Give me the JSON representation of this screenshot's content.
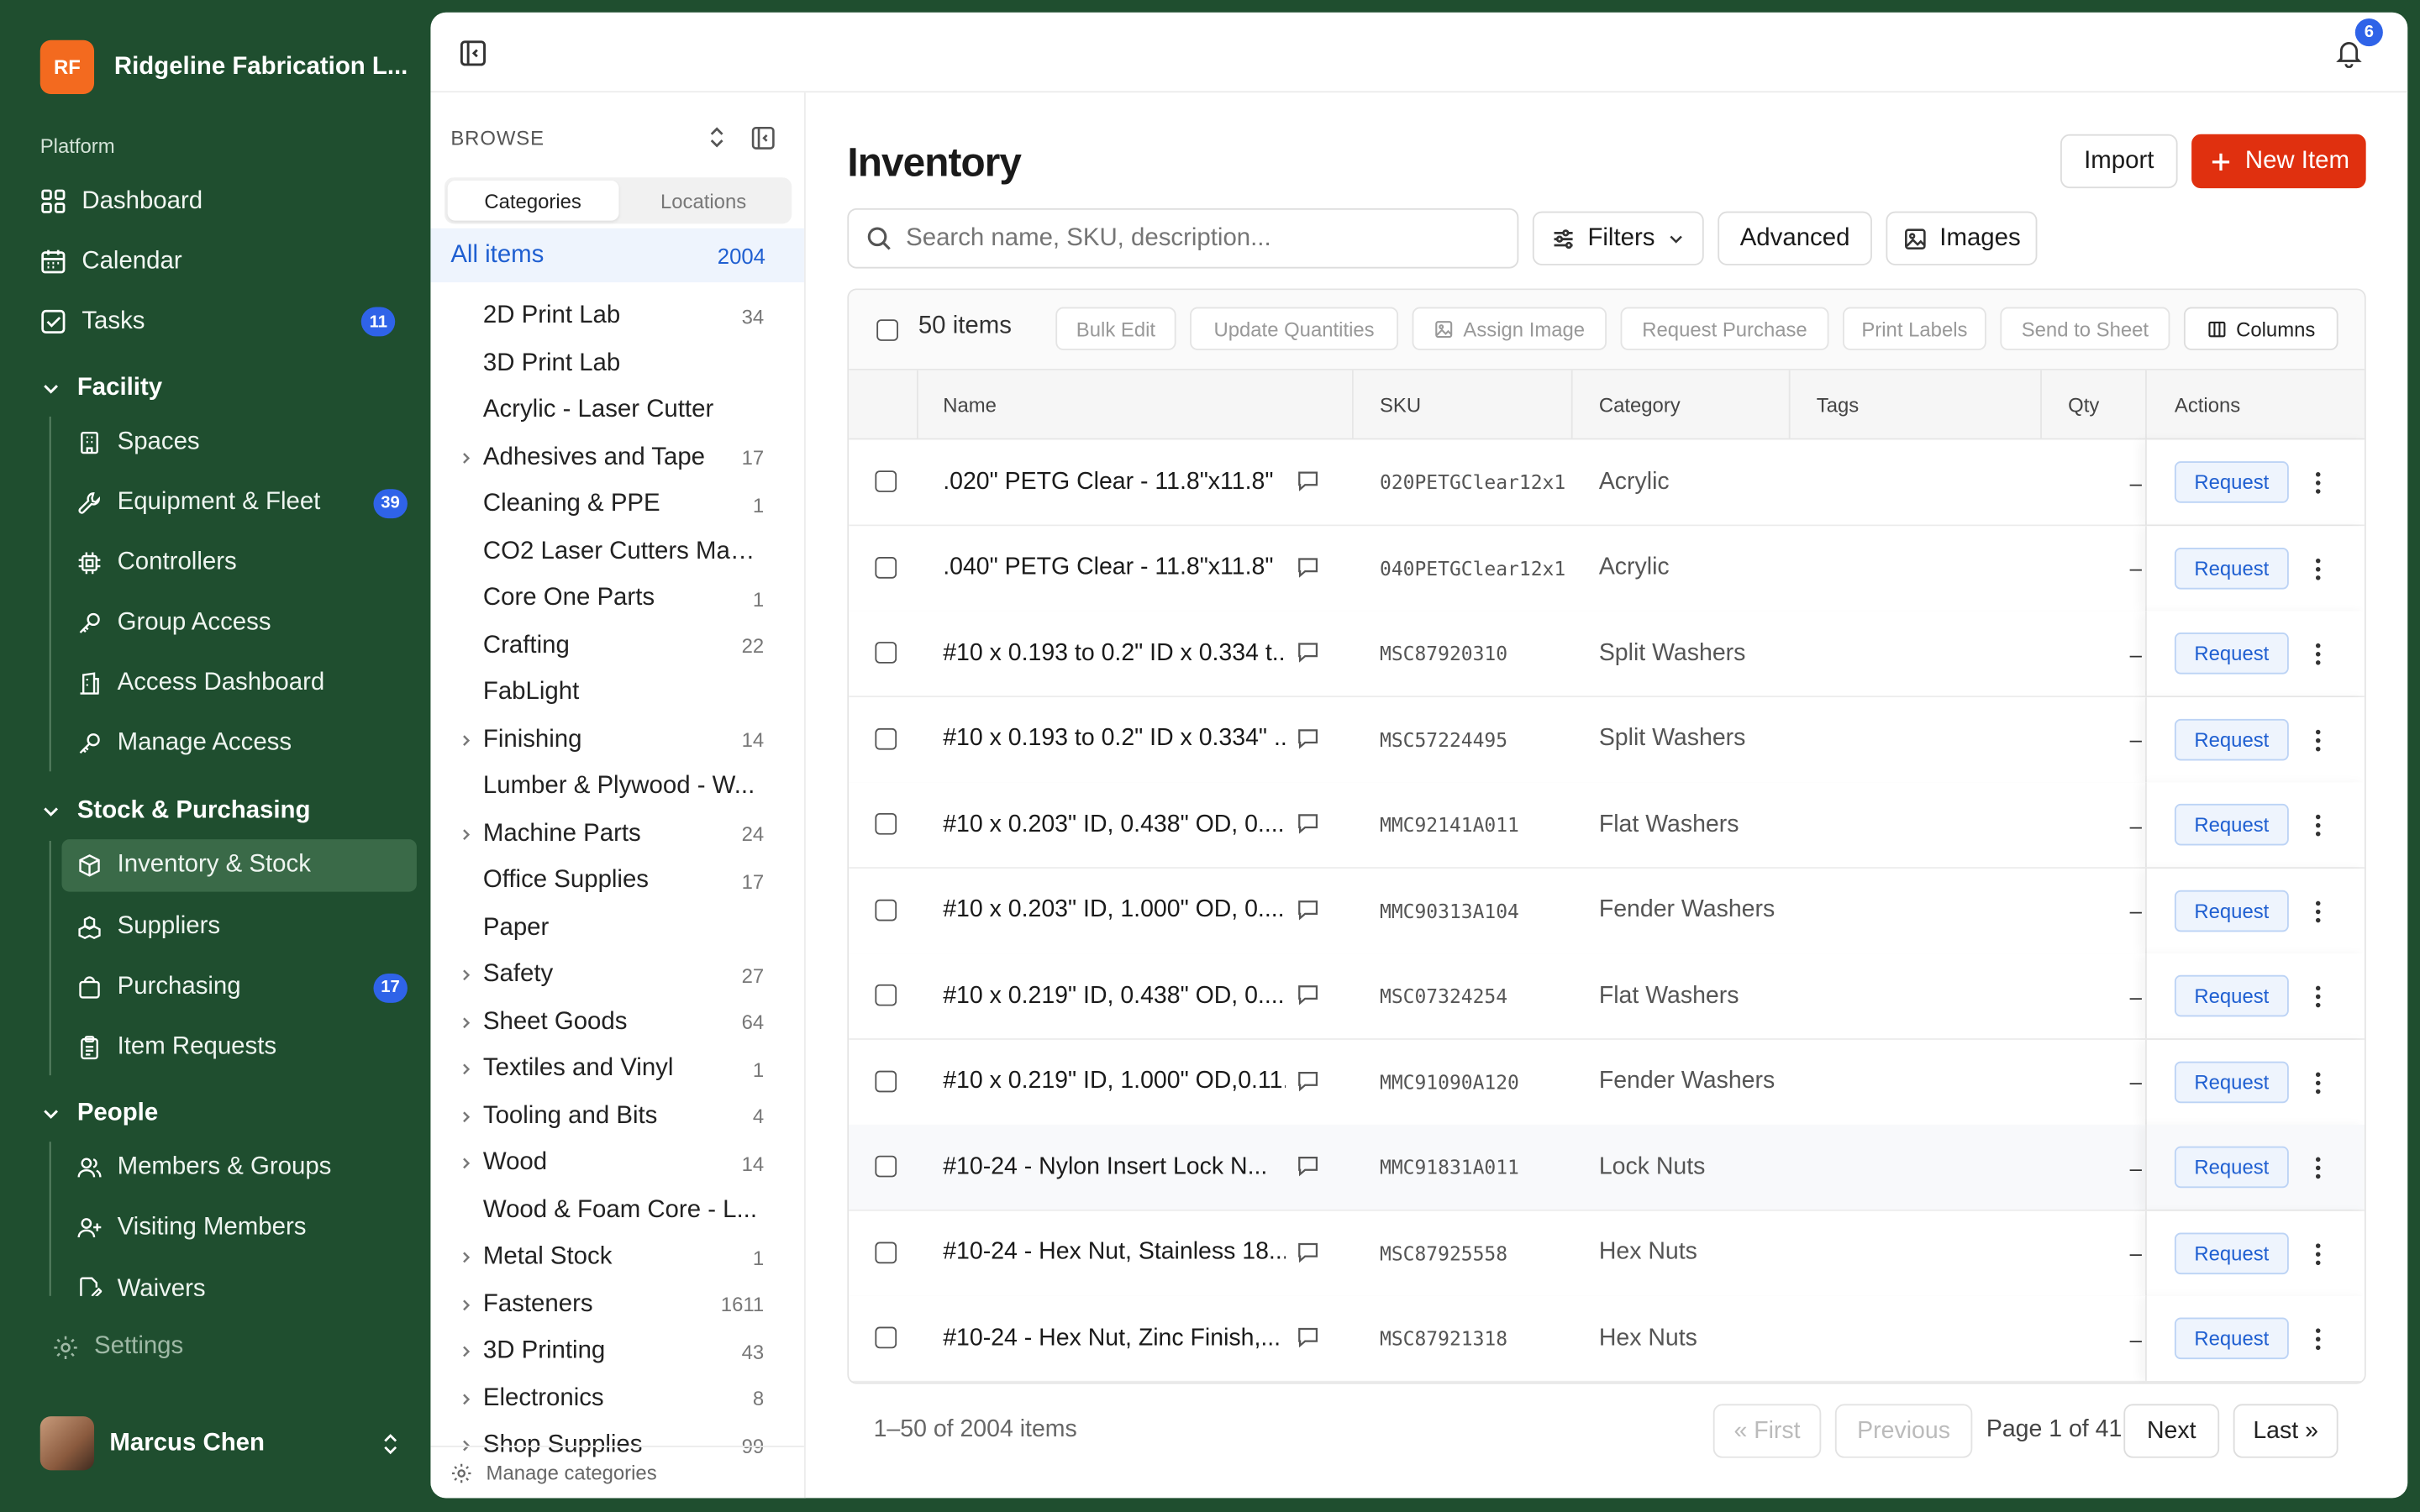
{
  "org": {
    "initials": "RF",
    "name": "Ridgeline Fabrication L..."
  },
  "sidebar": {
    "platform_label": "Platform",
    "platform_items": [
      {
        "label": "Dashboard",
        "icon": "grid-icon"
      },
      {
        "label": "Calendar",
        "icon": "calendar-icon"
      },
      {
        "label": "Tasks",
        "icon": "checkbox-icon",
        "badge": "11"
      }
    ],
    "groups": [
      {
        "label": "Facility",
        "items": [
          {
            "label": "Spaces",
            "icon": "building-icon"
          },
          {
            "label": "Equipment & Fleet",
            "icon": "wrench-icon",
            "badge": "39"
          },
          {
            "label": "Controllers",
            "icon": "chip-icon"
          },
          {
            "label": "Group Access",
            "icon": "key-icon"
          },
          {
            "label": "Access Dashboard",
            "icon": "building-icon"
          },
          {
            "label": "Manage Access",
            "icon": "key-icon"
          }
        ]
      },
      {
        "label": "Stock & Purchasing",
        "items": [
          {
            "label": "Inventory & Stock",
            "icon": "box-icon",
            "active": true
          },
          {
            "label": "Suppliers",
            "icon": "boxes-icon"
          },
          {
            "label": "Purchasing",
            "icon": "bag-icon",
            "badge": "17"
          },
          {
            "label": "Item Requests",
            "icon": "clipboard-icon"
          }
        ]
      },
      {
        "label": "People",
        "items": [
          {
            "label": "Members & Groups",
            "icon": "users-icon"
          },
          {
            "label": "Visiting Members",
            "icon": "user-plus-icon"
          },
          {
            "label": "Waivers",
            "icon": "doc-pen-icon"
          }
        ]
      }
    ],
    "settings_label": "Settings",
    "user_name": "Marcus Chen"
  },
  "topbar": {
    "notification_count": "6"
  },
  "browse": {
    "title": "BROWSE",
    "tabs": [
      "Categories",
      "Locations"
    ],
    "all_items": {
      "label": "All items",
      "count": "2004"
    },
    "categories": [
      {
        "label": "2D Print Lab",
        "count": "34",
        "expand": false
      },
      {
        "label": "3D Print Lab",
        "count": "",
        "expand": false
      },
      {
        "label": "Acrylic - Laser Cutter",
        "count": "",
        "expand": false
      },
      {
        "label": "Adhesives and Tape",
        "count": "17",
        "expand": true
      },
      {
        "label": "Cleaning & PPE",
        "count": "1",
        "expand": false
      },
      {
        "label": "CO2 Laser Cutters Main...",
        "count": "",
        "expand": false
      },
      {
        "label": "Core One Parts",
        "count": "1",
        "expand": false
      },
      {
        "label": "Crafting",
        "count": "22",
        "expand": false
      },
      {
        "label": "FabLight",
        "count": "",
        "expand": false
      },
      {
        "label": "Finishing",
        "count": "14",
        "expand": true
      },
      {
        "label": "Lumber & Plywood - W...",
        "count": "",
        "expand": false
      },
      {
        "label": "Machine Parts",
        "count": "24",
        "expand": true
      },
      {
        "label": "Office Supplies",
        "count": "17",
        "expand": false
      },
      {
        "label": "Paper",
        "count": "",
        "expand": false
      },
      {
        "label": "Safety",
        "count": "27",
        "expand": true
      },
      {
        "label": "Sheet Goods",
        "count": "64",
        "expand": true
      },
      {
        "label": "Textiles and Vinyl",
        "count": "1",
        "expand": true
      },
      {
        "label": "Tooling and Bits",
        "count": "4",
        "expand": true
      },
      {
        "label": "Wood",
        "count": "14",
        "expand": true
      },
      {
        "label": "Wood & Foam Core - L...",
        "count": "",
        "expand": false
      },
      {
        "label": "Metal Stock",
        "count": "1",
        "expand": true
      },
      {
        "label": "Fasteners",
        "count": "1611",
        "expand": true
      },
      {
        "label": "3D Printing",
        "count": "43",
        "expand": true
      },
      {
        "label": "Electronics",
        "count": "8",
        "expand": true
      },
      {
        "label": "Shop Supplies",
        "count": "99",
        "expand": true
      }
    ],
    "manage_label": "Manage categories"
  },
  "page": {
    "title": "Inventory",
    "import_label": "Import",
    "new_item_label": "New Item",
    "search_placeholder": "Search name, SKU, description...",
    "filters_label": "Filters",
    "advanced_label": "Advanced",
    "images_label": "Images"
  },
  "toolbar": {
    "count_label": "50 items",
    "bulk_edit": "Bulk Edit",
    "update_quantities": "Update Quantities",
    "assign_image": "Assign Image",
    "request_purchase": "Request Purchase",
    "print_labels": "Print Labels",
    "send_to_sheet": "Send to Sheet",
    "columns": "Columns"
  },
  "table": {
    "headers": {
      "name": "Name",
      "sku": "SKU",
      "category": "Category",
      "tags": "Tags",
      "qty": "Qty",
      "actions": "Actions"
    },
    "request_label": "Request",
    "rows": [
      {
        "name": ".020\" PETG Clear - 11.8\"x11.8\"",
        "sku": "020PETGClear12x1",
        "category": "Acrylic",
        "qty": "–"
      },
      {
        "name": ".040\" PETG Clear - 11.8\"x11.8\"",
        "sku": "040PETGClear12x1",
        "category": "Acrylic",
        "qty": "–"
      },
      {
        "name": "#10 x 0.193 to 0.2\" ID x 0.334 t...",
        "sku": "MSC87920310",
        "category": "Split Washers",
        "qty": "–"
      },
      {
        "name": "#10 x 0.193 to 0.2\" ID x 0.334\" ...",
        "sku": "MSC57224495",
        "category": "Split Washers",
        "qty": "–"
      },
      {
        "name": "#10 x 0.203\" ID, 0.438\" OD, 0....",
        "sku": "MMC92141A011",
        "category": "Flat Washers",
        "qty": "–"
      },
      {
        "name": "#10 x 0.203\" ID, 1.000\" OD, 0....",
        "sku": "MMC90313A104",
        "category": "Fender Washers",
        "qty": "–"
      },
      {
        "name": "#10 x 0.219\" ID, 0.438\" OD, 0....",
        "sku": "MSC07324254",
        "category": "Flat Washers",
        "qty": "–"
      },
      {
        "name": "#10 x 0.219\" ID, 1.000\" OD,0.11...",
        "sku": "MMC91090A120",
        "category": "Fender Washers",
        "qty": "–"
      },
      {
        "name": "#10-24 - Nylon Insert Lock N...",
        "sku": "MMC91831A011",
        "category": "Lock Nuts",
        "qty": "–"
      },
      {
        "name": "#10-24 - Hex Nut, Stainless 18...",
        "sku": "MSC87925558",
        "category": "Hex Nuts",
        "qty": "–"
      },
      {
        "name": "#10-24 - Hex Nut, Zinc Finish,...",
        "sku": "MSC87921318",
        "category": "Hex Nuts",
        "qty": "–"
      }
    ]
  },
  "pagination": {
    "summary": "1–50 of 2004 items",
    "first": "« First",
    "previous": "Previous",
    "page_info": "Page 1 of 41",
    "next": "Next",
    "last": "Last »"
  },
  "colors": {
    "sidebar_bg": "#1f4e2f",
    "accent": "#e0300f",
    "link": "#1f5fd1",
    "badge": "#2f63e8"
  }
}
